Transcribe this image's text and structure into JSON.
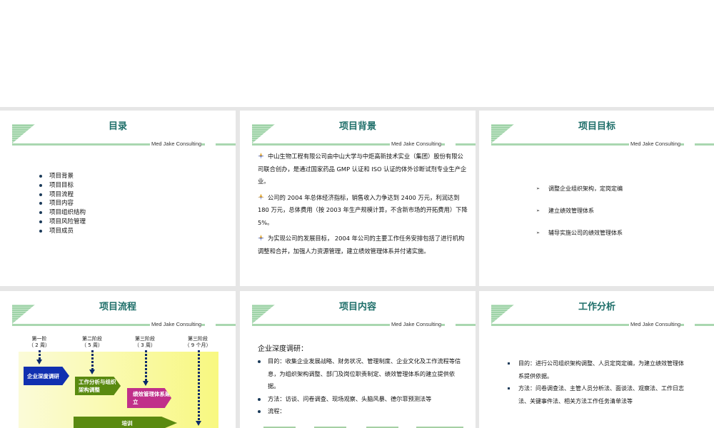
{
  "brand": "Med Jake Consulting",
  "slides": [
    {
      "title": "目录",
      "items": [
        "项目背景",
        "项目目标",
        "项目流程",
        "项目内容",
        "项目组织结构",
        "项目风险管理",
        "项目成员"
      ]
    },
    {
      "title": "项目背景",
      "paragraphs": [
        "中山生物工程有限公司由中山大学与中炬高新技术实业（集团）股份有限公司联合创办，是通过国家药品 GMP 认证和 ISO 认证的体外诊断试剂专业生产企业。",
        "公司的 2004 年总体经济指标，销售收入力争达到 2400 万元，利润达到 180 万元，总体费用（按 2003 年生产规模计算，不含新市场的开拓费用）下降 5%。",
        "为实现公司的发展目标， 2004 年公司的主要工作任务安排包括了进行机构调整和合并，加强人力资源管理，建立绩效管理体系并付诸实施。"
      ]
    },
    {
      "title": "项目目标",
      "items": [
        "调整企业组织架构，定岗定编",
        "建立绩效管理体系",
        "辅导实施公司的绩效管理体系"
      ]
    },
    {
      "title": "项目流程",
      "stages": [
        {
          "name": "第一阶",
          "dur": "（ 2 周）"
        },
        {
          "name": "第二阶段",
          "dur": "（ 5 周）"
        },
        {
          "name": "第三阶段",
          "dur": "（ 3 周）"
        },
        {
          "name": "第三阶段",
          "dur": "（ 9 个月）"
        }
      ],
      "boxes": [
        "企业深度调研",
        "工作分析与组织架构调整",
        "绩效管理体系建立",
        "培训"
      ],
      "colors": {
        "blue": "#1030b0",
        "green": "#5a8a10",
        "magenta": "#c0308a"
      }
    },
    {
      "title": "项目内容",
      "heading": "企业深度调研：",
      "items": [
        "目的：收集企业发展战略、财务状况、管理制度、企业文化及工作流程等信息，为组织架构调整、部门及岗位职责制定、绩效管理体系的建立提供依据。",
        "方法：访谈、问卷调查、现场观察、头脑风暴、德尔菲预测法等",
        "流程："
      ]
    },
    {
      "title": "工作分析",
      "items": [
        "目的：进行公司组织架构调整、人员定岗定编，为建立绩效管理体系提供依据。",
        "方法：问卷调查法、主管人员分析法、面谈法、观察法、工作日志法、关键事件法、相关方法工作任务清单法等"
      ]
    }
  ]
}
